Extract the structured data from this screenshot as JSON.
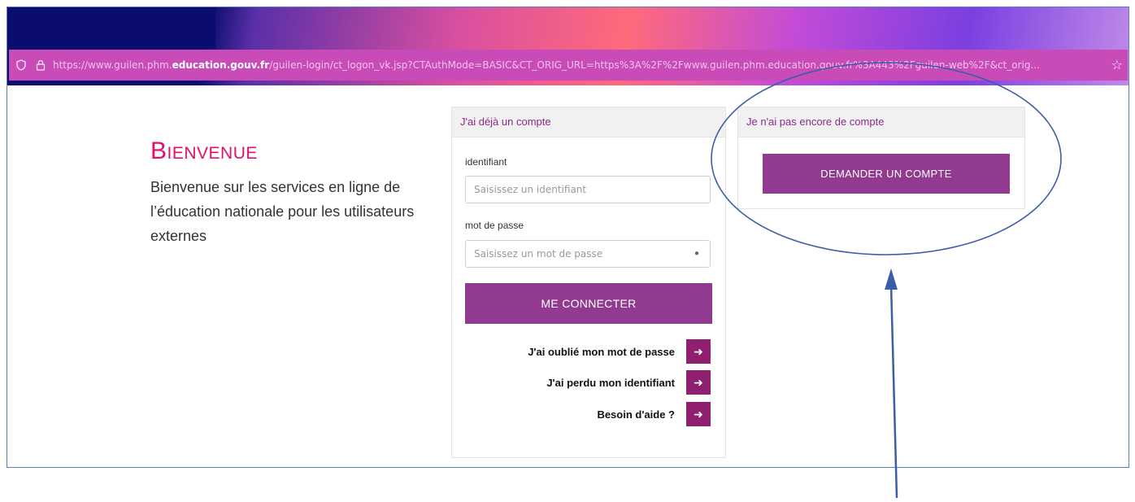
{
  "browser": {
    "url_prefix": "https://www.guilen.phm.",
    "url_domain": "education.gouv.fr",
    "url_rest": "/guilen-login/ct_logon_vk.jsp?CTAuthMode=BASIC&CT_ORIG_URL=https%3A%2F%2Fwww.guilen.phm.education.gouv.fr%3A443%2Fguilen-web%2F&ct_orig..."
  },
  "welcome": {
    "title": "Bienvenue",
    "text": "Bienvenue sur les services en ligne de l’éducation nationale pour les utilisateurs externes"
  },
  "login": {
    "header": "J'ai déjà un compte",
    "id_label": "identifiant",
    "id_placeholder": "Saisissez un identifiant",
    "pw_label": "mot de passe",
    "pw_placeholder": "Saisissez un mot de passe",
    "submit": "ME CONNECTER",
    "links": [
      {
        "label": "J'ai oublié mon mot de passe"
      },
      {
        "label": "J'ai perdu mon identifiant"
      },
      {
        "label": "Besoin d'aide ?"
      }
    ]
  },
  "signup": {
    "header": "Je n'ai pas encore de compte",
    "button": "DEMANDER UN COMPTE"
  },
  "colors": {
    "accent": "#923a8f",
    "title": "#e0106f",
    "annotation": "#3c5ea8"
  },
  "icons": [
    "shield-icon",
    "lock-icon",
    "star-icon",
    "eye-icon",
    "arrow-right-icon"
  ]
}
